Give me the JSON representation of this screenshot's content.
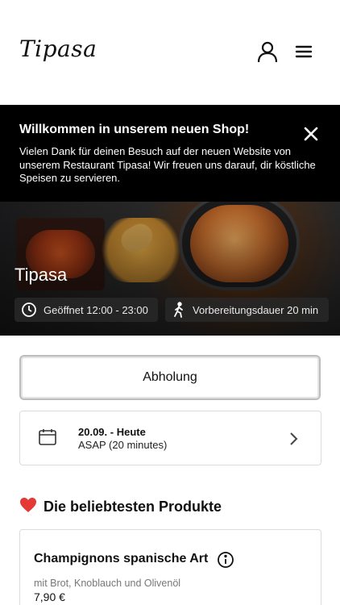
{
  "header": {
    "logo_text": "Tipasa",
    "icons": {
      "account": "user-icon",
      "menu": "hamburger-menu-icon"
    }
  },
  "banner": {
    "title": "Willkommen in unserem neuen Shop!",
    "text": "Vielen Dank für deinen Besuch auf der neuen Website von unserem Restaurant Tipasa! Wir freuen uns darauf, dir köstliche Speisen zu servieren.",
    "close_icon": "close-icon"
  },
  "hero": {
    "title": "Tipasa",
    "opening_hours": "Geöffnet 12:00 - 23:00",
    "preparation_time": "Vorbereitungsdauer 20 min"
  },
  "order": {
    "mode_label": "Abholung",
    "date_main": "20.09. - Heute",
    "date_sub": "ASAP (20 minutes)"
  },
  "section": {
    "title": "Die beliebtesten Produkte",
    "icon": "heart-icon"
  },
  "products": [
    {
      "name": "Champignons spanische Art",
      "description": "mit Brot, Knoblauch und Olivenöl",
      "price": "7,90 €"
    }
  ],
  "colors": {
    "banner_bg": "#000000",
    "heart": "#e53935",
    "border": "#dcdcdc"
  }
}
